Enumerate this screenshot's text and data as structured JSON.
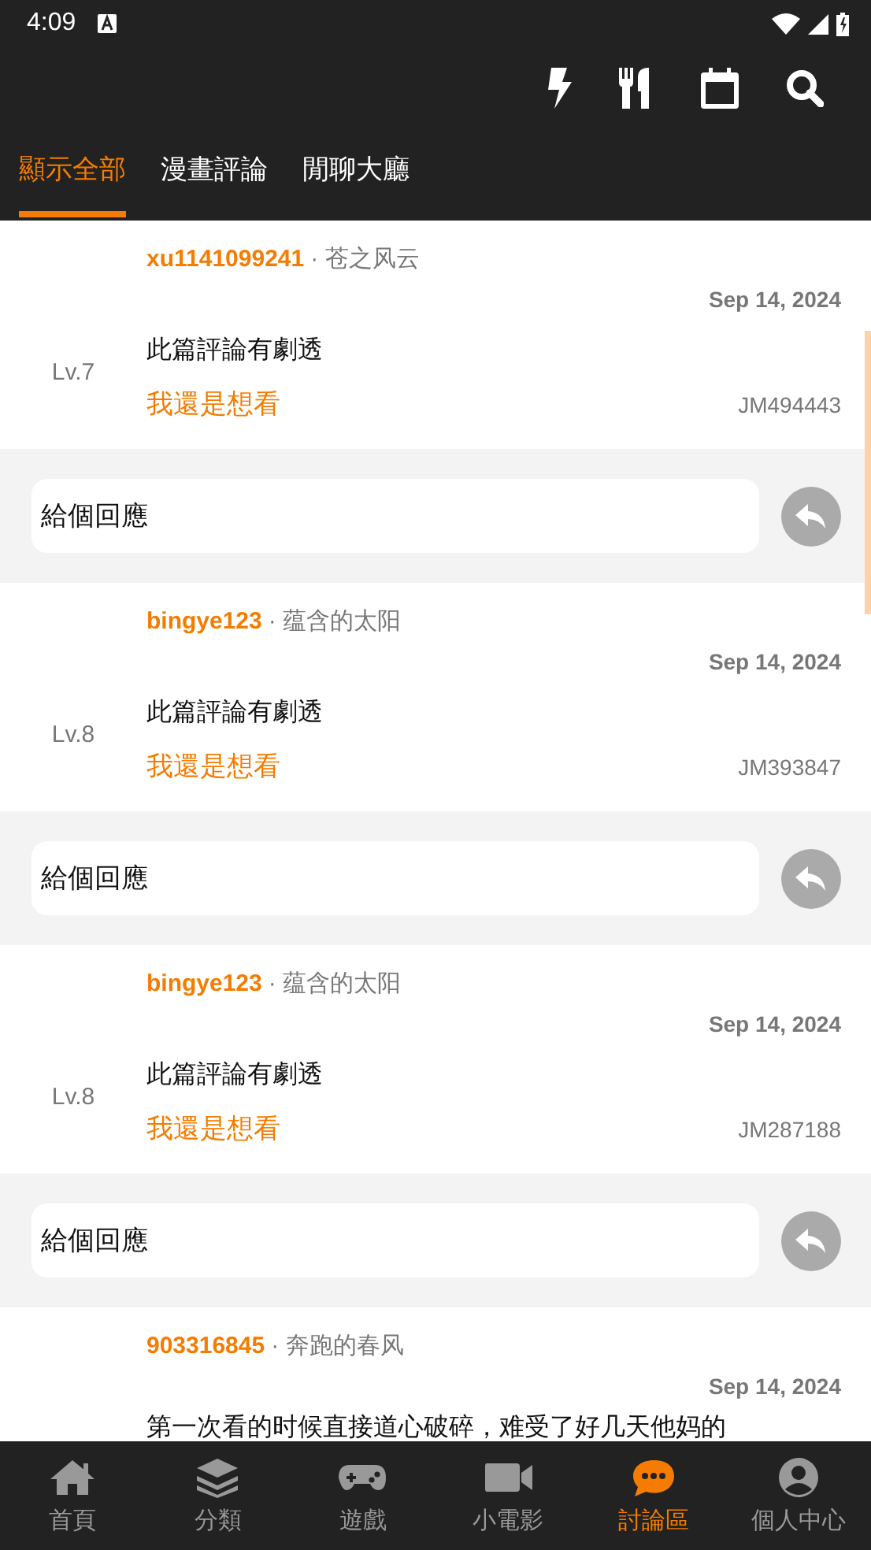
{
  "status_bar": {
    "time": "4:09"
  },
  "tabs": [
    {
      "label": "顯示全部",
      "selected": true
    },
    {
      "label": "漫畫評論",
      "selected": false
    },
    {
      "label": "閒聊大廳",
      "selected": false
    }
  ],
  "comments": [
    {
      "user": "xu1141099241",
      "nickname": "· 苍之风云",
      "date": "Sep 14, 2024",
      "level": "Lv.7",
      "text": "此篇評論有劇透",
      "spoiler_link": "我還是想看",
      "comic_id": "JM494443",
      "reply_placeholder": "給個回應"
    },
    {
      "user": "bingye123",
      "nickname": "· 蕴含的太阳",
      "date": "Sep 14, 2024",
      "level": "Lv.8",
      "text": "此篇評論有劇透",
      "spoiler_link": "我還是想看",
      "comic_id": "JM393847",
      "reply_placeholder": "給個回應"
    },
    {
      "user": "bingye123",
      "nickname": "· 蕴含的太阳",
      "date": "Sep 14, 2024",
      "level": "Lv.8",
      "text": "此篇評論有劇透",
      "spoiler_link": "我還是想看",
      "comic_id": "JM287188",
      "reply_placeholder": "給個回應"
    },
    {
      "user": "903316845",
      "nickname": "· 奔跑的春风",
      "date": "Sep 14, 2024",
      "text": "第一次看的时候直接道心破碎，难受了好几天他妈的"
    }
  ],
  "bottom_nav": [
    {
      "kind": "home",
      "label": "首頁",
      "selected": false
    },
    {
      "kind": "layers",
      "label": "分類",
      "selected": false
    },
    {
      "kind": "game",
      "label": "遊戲",
      "selected": false
    },
    {
      "kind": "video",
      "label": "小電影",
      "selected": false
    },
    {
      "kind": "chat",
      "label": "討論區",
      "selected": true
    },
    {
      "kind": "person",
      "label": "個人中心",
      "selected": false
    }
  ]
}
